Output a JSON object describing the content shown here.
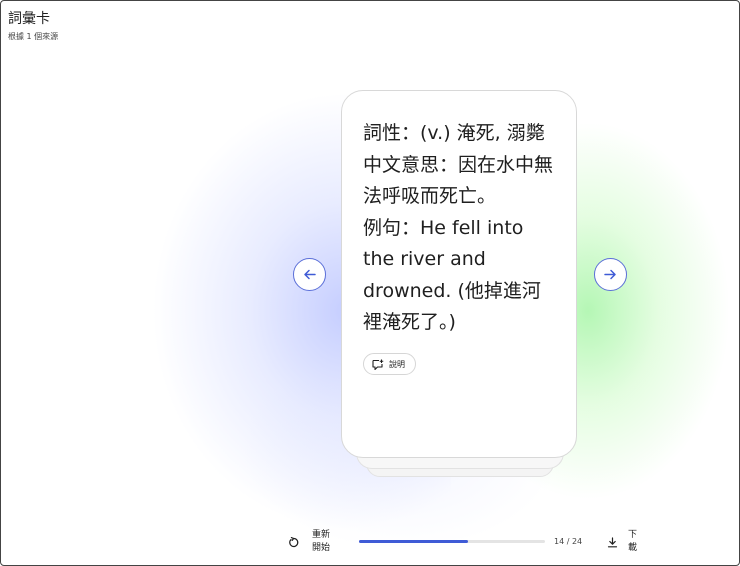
{
  "header": {
    "title": "詞彙卡",
    "subtitle": "根據 1 個來源"
  },
  "card": {
    "text": "詞性：(v.) 淹死, 溺斃\n中文意思：因在水中無法呼吸而死亡。\n例句：He fell into the river and drowned. (他掉進河裡淹死了。)",
    "explain_label": "說明"
  },
  "navigation": {
    "prev_icon": "arrow-left-icon",
    "next_icon": "arrow-right-icon"
  },
  "footer": {
    "restart_label": "重新開始",
    "progress_text": "14 / 24",
    "progress_current": 14,
    "progress_total": 24,
    "download_label": "下載"
  },
  "colors": {
    "accent": "#3f5bd6",
    "glow_left": "#a5b1ff",
    "glow_right": "#8ff08f"
  }
}
